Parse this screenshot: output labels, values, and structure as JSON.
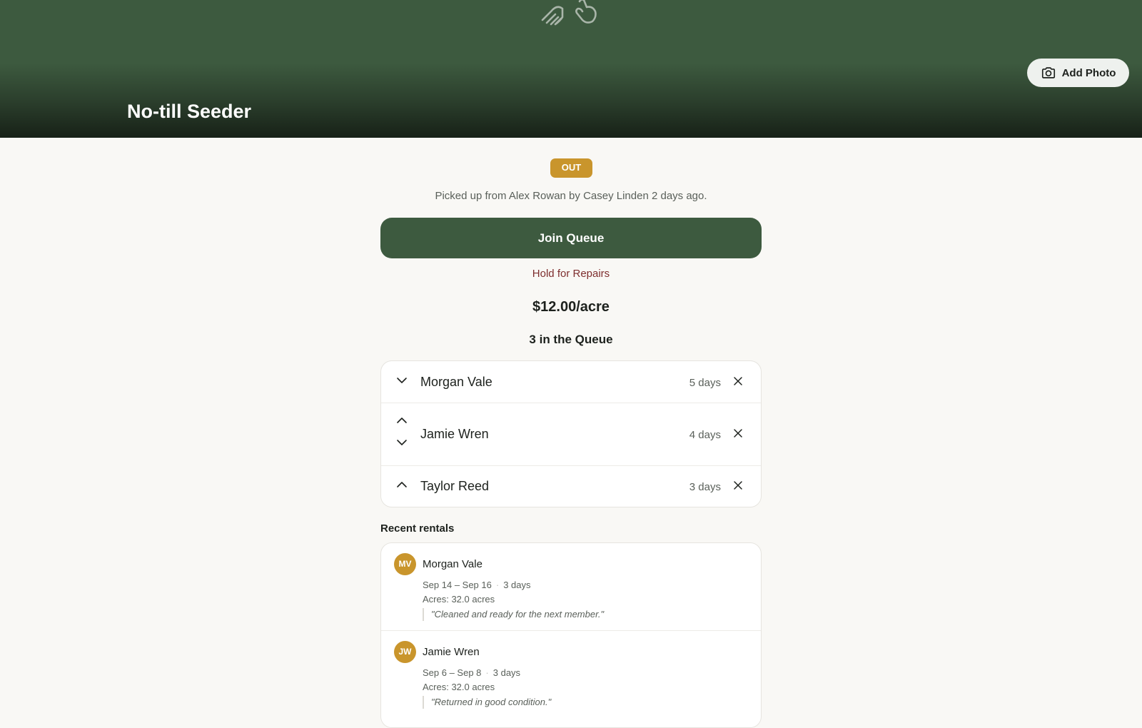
{
  "header": {
    "title": "No-till Seeder",
    "add_photo_label": "Add Photo",
    "accent_color": "#3d5a3f"
  },
  "status": {
    "badge": "OUT",
    "badge_color": "#c9952c",
    "detail": "Picked up from Alex Rowan by Casey Linden 2 days ago."
  },
  "actions": {
    "join_queue_label": "Join Queue",
    "hold_label": "Hold for Repairs"
  },
  "price": "$12.00/acre",
  "queue": {
    "title": "3 in the Queue",
    "items": [
      {
        "name": "Morgan Vale",
        "days": "5 days",
        "arrows": [
          "down"
        ]
      },
      {
        "name": "Jamie Wren",
        "days": "4 days",
        "arrows": [
          "up",
          "down"
        ]
      },
      {
        "name": "Taylor Reed",
        "days": "3 days",
        "arrows": [
          "up"
        ]
      }
    ]
  },
  "recent": {
    "title": "Recent rentals",
    "items": [
      {
        "initials": "MV",
        "name": "Morgan Vale",
        "dates": "Sep 14 – Sep 16",
        "duration": "3 days",
        "acres": "Acres: 32.0 acres",
        "note": "\"Cleaned and ready for the next member.\""
      },
      {
        "initials": "JW",
        "name": "Jamie Wren",
        "dates": "Sep 6 – Sep 8",
        "duration": "3 days",
        "acres": "Acres: 32.0 acres",
        "note": "\"Returned in good condition.\""
      }
    ]
  },
  "icons": {
    "hero": "seeder-hand-icon",
    "add_photo": "camera-icon",
    "move_up": "chevron-up-icon",
    "move_down": "chevron-down-icon",
    "remove": "close-icon"
  }
}
